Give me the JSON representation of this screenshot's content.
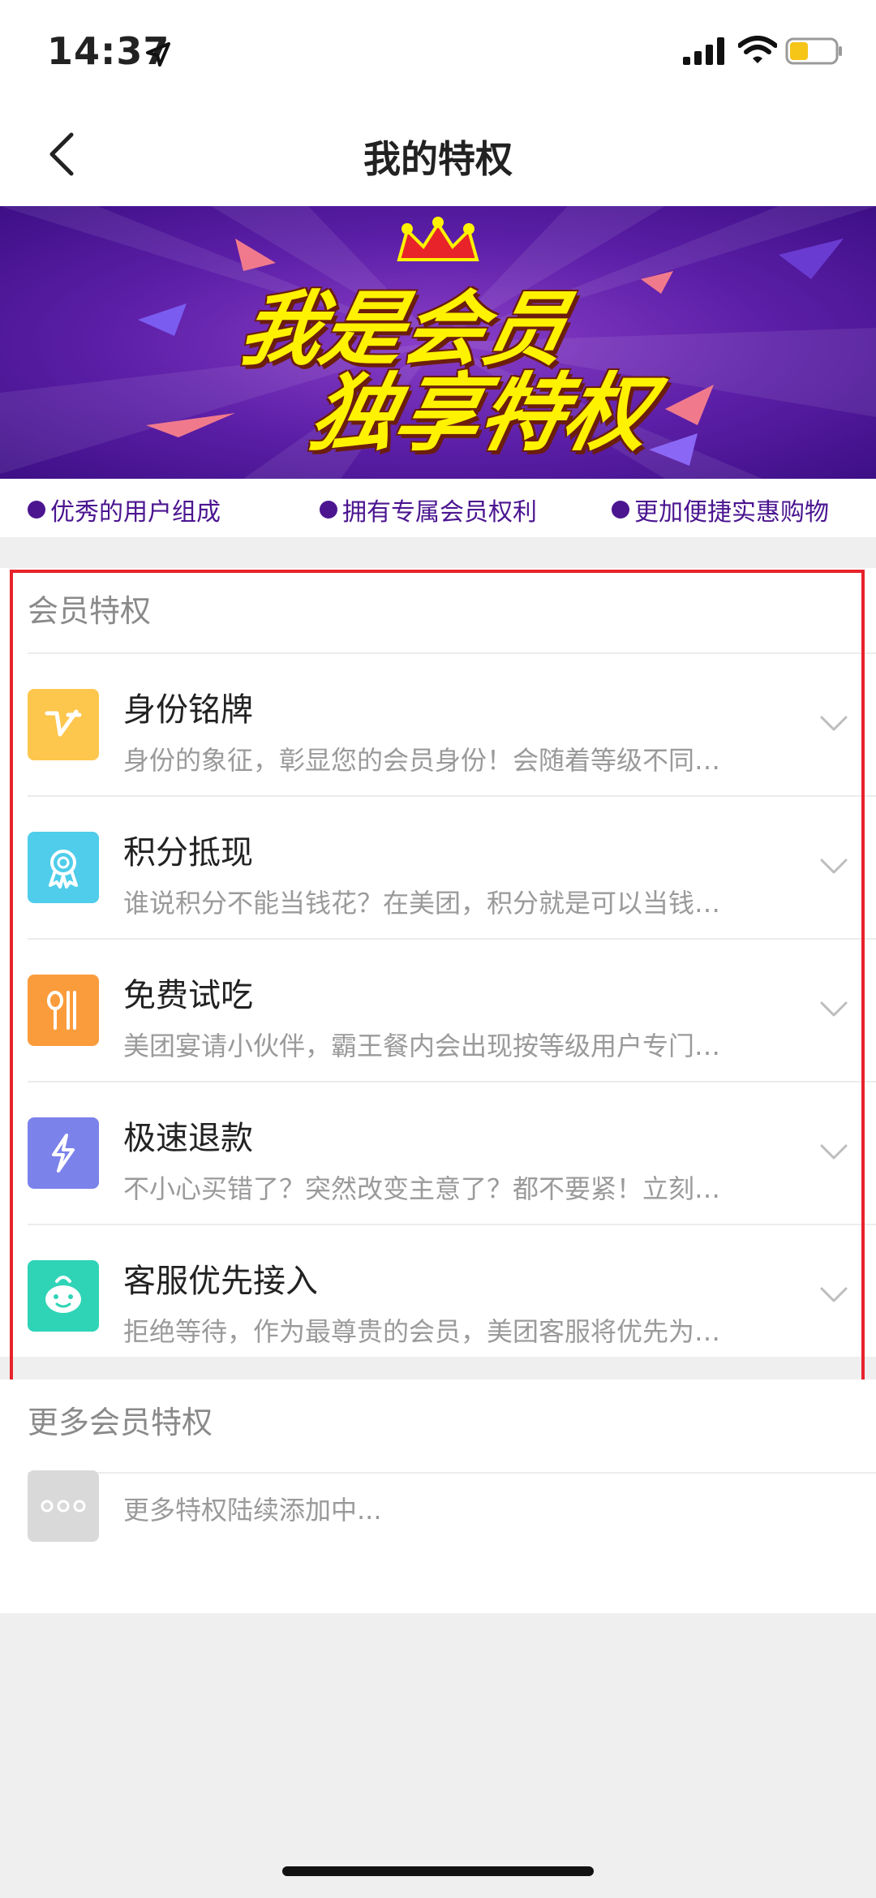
{
  "status": {
    "time": "14:37"
  },
  "nav": {
    "title": "我的特权"
  },
  "banner": {
    "line1": "我是会员",
    "line2": "独享特权"
  },
  "bullets": [
    {
      "label": "优秀的用户组成"
    },
    {
      "label": "拥有专属会员权利"
    },
    {
      "label": "更加便捷实惠购物"
    }
  ],
  "section1": {
    "title": "会员特权",
    "items": [
      {
        "title": "身份铭牌",
        "desc": "身份的象征，彰显您的会员身份！会随着等级不同…",
        "icon": "v-badge-icon",
        "color": "#fdc64d"
      },
      {
        "title": "积分抵现",
        "desc": "谁说积分不能当钱花？在美团，积分就是可以当钱…",
        "icon": "award-ribbon-icon",
        "color": "#4fcdea"
      },
      {
        "title": "免费试吃",
        "desc": "美团宴请小伙伴，霸王餐内会出现按等级用户专门…",
        "icon": "spoon-fork-icon",
        "color": "#fb9c3c"
      },
      {
        "title": "极速退款",
        "desc": "不小心买错了？突然改变主意了？都不要紧！立刻…",
        "icon": "lightning-icon",
        "color": "#7b82ea"
      },
      {
        "title": "客服优先接入",
        "desc": "拒绝等待，作为最尊贵的会员，美团客服将优先为…",
        "icon": "mascot-face-icon",
        "color": "#2fd4b6"
      }
    ]
  },
  "section2": {
    "title": "更多会员特权",
    "more_text": "更多特权陆续添加中..."
  },
  "colors": {
    "accent_purple": "#4b1590",
    "highlight_red": "#e8232a"
  }
}
